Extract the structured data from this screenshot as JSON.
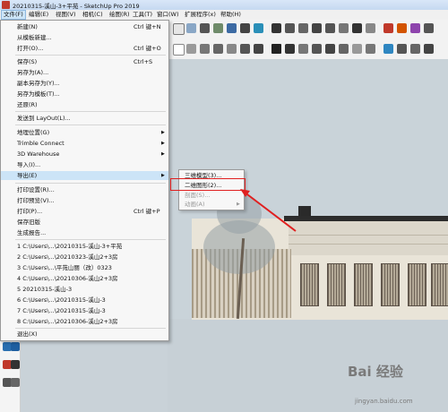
{
  "window": {
    "title": "20210315-溪山-3+平苑 - SketchUp Pro 2019"
  },
  "menubar": [
    {
      "label": "文件(F)"
    },
    {
      "label": "编辑(E)"
    },
    {
      "label": "视图(V)"
    },
    {
      "label": "相机(C)"
    },
    {
      "label": "绘图(R)"
    },
    {
      "label": "工具(T)"
    },
    {
      "label": "窗口(W)"
    },
    {
      "label": "扩展程序(x)"
    },
    {
      "label": "帮助(H)"
    }
  ],
  "file_menu": {
    "items": [
      {
        "label": "新建(N)",
        "shortcut": "Ctrl 键+N"
      },
      {
        "label": "从模板新建..."
      },
      {
        "label": "打开(O)...",
        "shortcut": "Ctrl 键+O"
      },
      {
        "label": "保存(S)",
        "shortcut": "Ctrl+S"
      },
      {
        "label": "另存为(A)..."
      },
      {
        "label": "副本另存为(Y)..."
      },
      {
        "label": "另存为模板(T)..."
      },
      {
        "label": "还原(R)"
      },
      {
        "label": "发送到 LayOut(L)..."
      },
      {
        "label": "地理位置(G)"
      },
      {
        "label": "Trimble Connect"
      },
      {
        "label": "3D Warehouse"
      },
      {
        "label": "导入(I)..."
      },
      {
        "label": "导出(E)"
      },
      {
        "label": "打印设置(R)..."
      },
      {
        "label": "打印预览(V)..."
      },
      {
        "label": "打印(P)...",
        "shortcut": "Ctrl 键+P"
      },
      {
        "label": "保存旧版"
      },
      {
        "label": "生成报告..."
      },
      {
        "label": "1 C:\\Users\\...\\20210315-溪山-3+平苑"
      },
      {
        "label": "2 C:\\Users\\...\\20210323-溪山2+3房"
      },
      {
        "label": "3 C:\\Users\\...\\平苑山丽（改）0323"
      },
      {
        "label": "4 C:\\Users\\...\\20210306-溪山2+3房"
      },
      {
        "label": "5 20210315-溪山-3"
      },
      {
        "label": "6 C:\\Users\\...\\20210315-溪山-3"
      },
      {
        "label": "7 C:\\Users\\...\\20210315-溪山-3"
      },
      {
        "label": "8 C:\\Users\\...\\20210306-溪山2+3房"
      },
      {
        "label": "退出(X)"
      }
    ]
  },
  "export_submenu": {
    "items": [
      {
        "label": "三维模型(3)..."
      },
      {
        "label": "二维图形(2)..."
      },
      {
        "label": "剖面(S)..."
      },
      {
        "label": "动画(A)"
      }
    ]
  },
  "watermark": {
    "brand": "Bai 经验",
    "site": "jingyan.baidu.com"
  },
  "colors": {
    "menu_highlight": "#cce4f7",
    "annotation_red": "#e02020"
  }
}
